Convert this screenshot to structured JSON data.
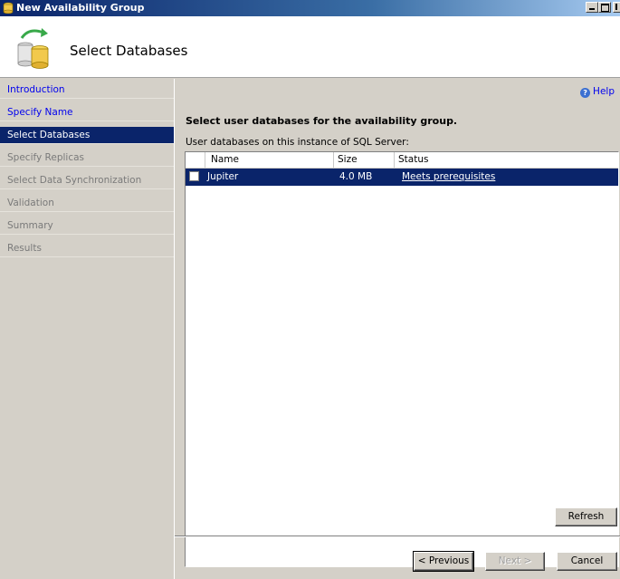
{
  "window": {
    "title": "New Availability Group"
  },
  "header": {
    "page_title": "Select Databases"
  },
  "nav": {
    "items": [
      {
        "label": "Introduction",
        "state": "link"
      },
      {
        "label": "Specify Name",
        "state": "link"
      },
      {
        "label": "Select Databases",
        "state": "selected"
      },
      {
        "label": "Specify Replicas",
        "state": "disabled"
      },
      {
        "label": "Select Data Synchronization",
        "state": "disabled"
      },
      {
        "label": "Validation",
        "state": "disabled"
      },
      {
        "label": "Summary",
        "state": "disabled"
      },
      {
        "label": "Results",
        "state": "disabled"
      }
    ]
  },
  "main": {
    "help_label": "Help",
    "instruction": "Select user databases for the availability group.",
    "sublabel": "User databases on this instance of SQL Server:",
    "grid": {
      "columns": [
        "Name",
        "Size",
        "Status"
      ],
      "rows": [
        {
          "checked": false,
          "name": "Jupiter",
          "size": "4.0 MB",
          "status": "Meets prerequisites"
        }
      ]
    },
    "refresh_label": "Refresh"
  },
  "footer": {
    "previous_label": "< Previous",
    "next_label": "Next >",
    "cancel_label": "Cancel"
  },
  "colors": {
    "selection": "#0a246a",
    "link": "#0000ee",
    "dialog_bg": "#d4d0c8"
  }
}
